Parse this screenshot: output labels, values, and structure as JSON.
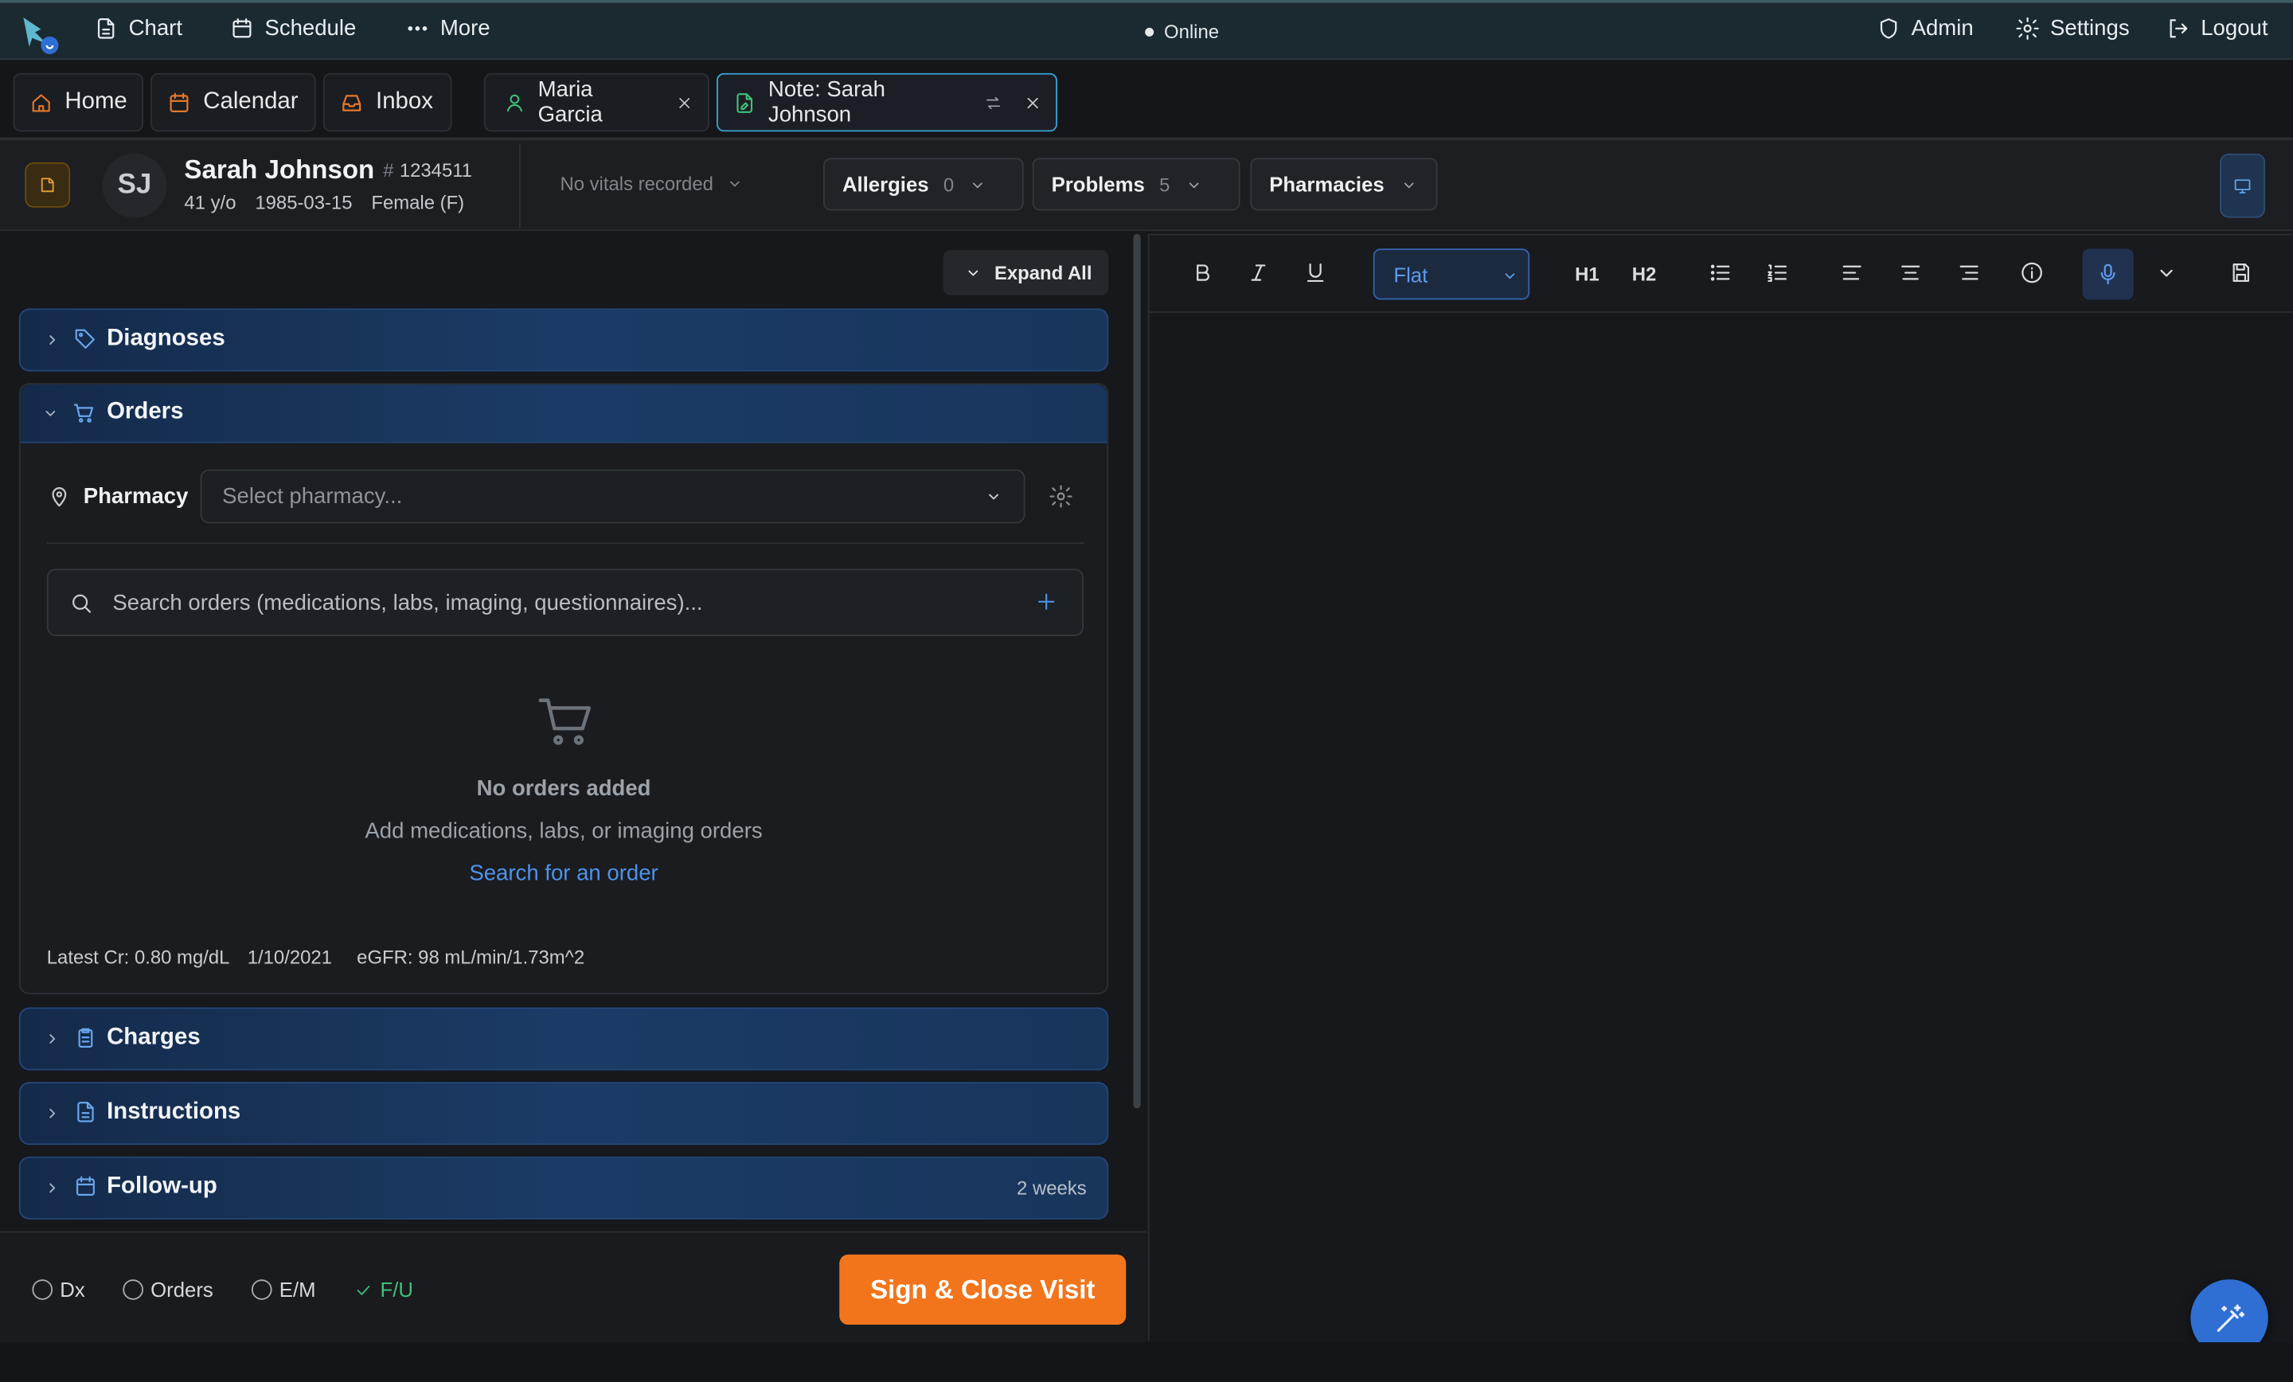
{
  "nav": {
    "chart": "Chart",
    "schedule": "Schedule",
    "more": "More",
    "status": "Online",
    "admin": "Admin",
    "settings": "Settings",
    "logout": "Logout"
  },
  "tabs": {
    "home": "Home",
    "calendar": "Calendar",
    "inbox": "Inbox",
    "patient_tab": "Maria Garcia",
    "note_tab": "Note: Sarah Johnson"
  },
  "patient": {
    "initials": "SJ",
    "name": "Sarah Johnson",
    "mrn_prefix": "#",
    "mrn": "1234511",
    "age": "41 y/o",
    "dob": "1985-03-15",
    "sex": "Female (F)",
    "vitals": "No vitals recorded",
    "allergies_label": "Allergies",
    "allergies_count": "0",
    "problems_label": "Problems",
    "problems_count": "5",
    "pharmacies_label": "Pharmacies"
  },
  "left": {
    "expand_all": "Expand All",
    "sections": {
      "diagnoses": "Diagnoses",
      "orders": "Orders",
      "charges": "Charges",
      "instructions": "Instructions",
      "followup": "Follow-up",
      "followup_value": "2 weeks"
    },
    "orders": {
      "pharmacy_label": "Pharmacy",
      "pharmacy_placeholder": "Select pharmacy...",
      "search_placeholder": "Search orders (medications, labs, imaging, questionnaires)...",
      "empty_title": "No orders added",
      "empty_sub": "Add medications, labs, or imaging orders",
      "empty_link": "Search for an order",
      "cr_label": "Latest Cr:",
      "cr_value": "0.80 mg/dL",
      "cr_date": "1/10/2021",
      "egfr_label": "eGFR:",
      "egfr_value": "98 mL/min/1.73m^2"
    }
  },
  "bottom": {
    "dx": "Dx",
    "orders": "Orders",
    "em": "E/M",
    "fu": "F/U",
    "sign": "Sign & Close Visit"
  },
  "editor": {
    "format_value": "Flat",
    "h1": "H1",
    "h2": "H2"
  },
  "colors": {
    "accent_orange": "#f2751c",
    "accent_blue": "#4e93ea",
    "done_green": "#3ec17a"
  }
}
